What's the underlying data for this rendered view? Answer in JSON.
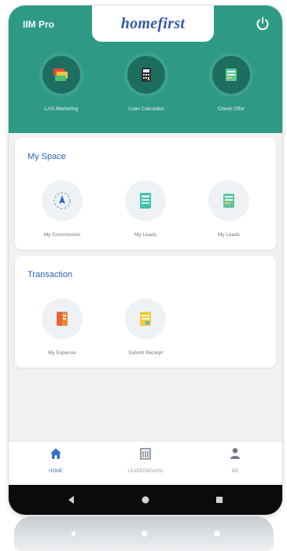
{
  "header": {
    "app_label": "IIM Pro",
    "logo_text": "homefirst",
    "power_icon": "power-icon",
    "quick_actions": [
      {
        "label": "LAS Marketing",
        "icon": "cards-icon"
      },
      {
        "label": "Loan Calculator",
        "icon": "calculator-icon"
      },
      {
        "label": "Check Offer",
        "icon": "offer-doc-icon"
      }
    ]
  },
  "my_space": {
    "title": "My Space",
    "items": [
      {
        "label": "My Commission",
        "icon": "commission-icon"
      },
      {
        "label": "My Leads",
        "icon": "leads-icon"
      },
      {
        "label": "My Leads",
        "icon": "leads-list-icon"
      }
    ]
  },
  "transaction": {
    "title": "Transaction",
    "items": [
      {
        "label": "My Expense",
        "icon": "expense-icon"
      },
      {
        "label": "Submit Receipt",
        "icon": "receipt-icon"
      }
    ]
  },
  "bottom_nav": [
    {
      "label": "HOME",
      "icon": "home-icon",
      "active": true
    },
    {
      "label": "LEADERBOARD",
      "icon": "building-icon",
      "active": false
    },
    {
      "label": "ME",
      "icon": "user-icon",
      "active": false
    }
  ],
  "colors": {
    "header": "#2e9a86",
    "quick_circle": "#1d6e5f",
    "section_title": "#2f63b6",
    "logo": "#3659a8",
    "active_nav": "#3a6cc5"
  }
}
